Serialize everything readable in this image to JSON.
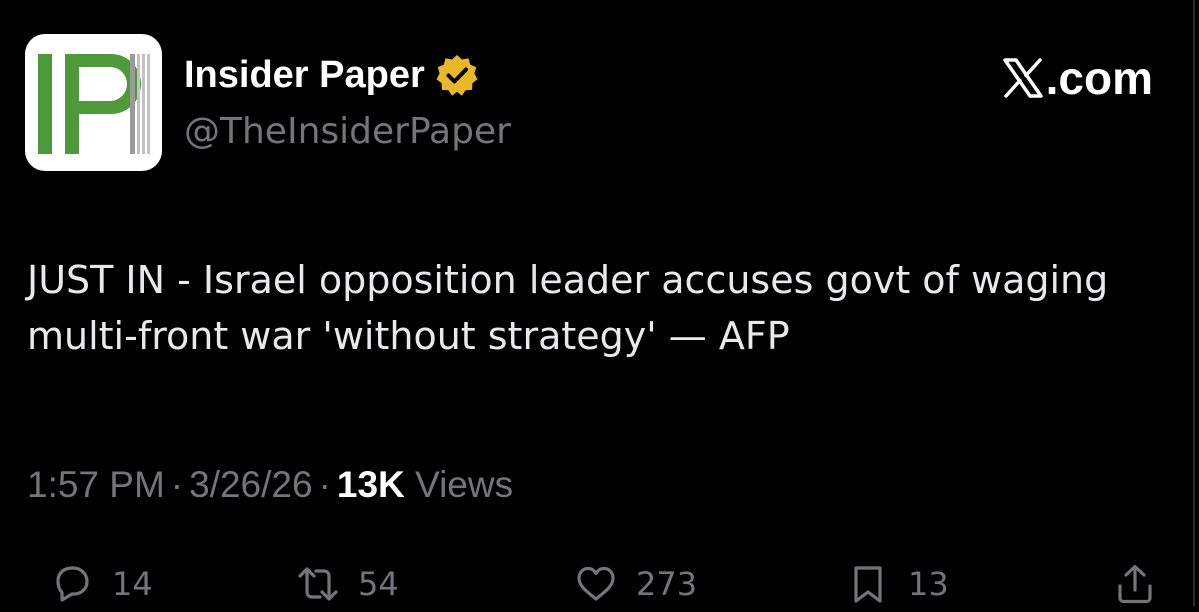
{
  "account": {
    "display_name": "Insider Paper",
    "handle": "@TheInsiderPaper",
    "avatar_text": "IP",
    "verified_badge_color": "#e8b828",
    "avatar_letter_color": "#4e9a3a"
  },
  "site": {
    "watermark": ".com"
  },
  "tweet": {
    "text": "JUST IN - Israel opposition leader accuses govt of waging multi-front war 'without strategy' — AFP",
    "time": "1:57 PM",
    "separator": "·",
    "date": "3/26/26",
    "views_count": "13K",
    "views_label": "Views"
  },
  "actions": {
    "replies": "14",
    "reposts": "54",
    "likes": "273",
    "bookmarks": "13"
  },
  "colors": {
    "background": "#000000",
    "primary_text": "#e7e9ea",
    "secondary_text": "#71767b"
  }
}
